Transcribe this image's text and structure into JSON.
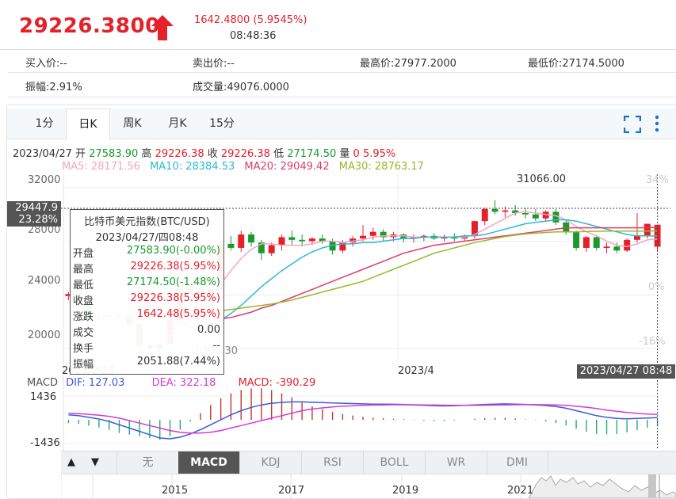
{
  "quote": {
    "price": "29226.3800",
    "change": "1642.4800 (5.9545%)",
    "time": "08:48:36"
  },
  "info": {
    "bid": "买入价:--",
    "ask": "卖出价:--",
    "high": "最高价:27977.2000",
    "low": "最低价:27174.5000",
    "amplitude": "振幅:2.91%",
    "volume": "成交量:49076.0000"
  },
  "tabs": [
    "1分",
    "日K",
    "周K",
    "月K",
    "15分"
  ],
  "active_tab": "日K",
  "ohlc_line": {
    "date": "2023/04/27",
    "open_label": "开",
    "open": "27583.90",
    "high_label": "高",
    "high": "29226.38",
    "close_label": "收",
    "close": "29226.38",
    "low_label": "低",
    "low": "27174.50",
    "vol_label": "量",
    "vol": "0",
    "pct": "5.95%"
  },
  "ma_line": {
    "ma5": "MA5: 28171.56",
    "ma10": "MA10: 28384.53",
    "ma20": "MA20: 29049.42",
    "ma30": "MA30: 28763.17"
  },
  "tooltip": {
    "title": "比特币美元指数(BTC/USD)",
    "datetime": "2023/04/27/四08:48",
    "rows": [
      {
        "k": "开盘",
        "v": "27583.90(-0.00%)",
        "c": "green"
      },
      {
        "k": "最高",
        "v": "29226.38(5.95%)",
        "c": "red"
      },
      {
        "k": "最低",
        "v": "27174.50(-1.48%)",
        "c": "green"
      },
      {
        "k": "收盘",
        "v": "29226.38(5.95%)",
        "c": "red"
      },
      {
        "k": "涨跌",
        "v": "1642.48(5.95%)",
        "c": "red"
      },
      {
        "k": "成交",
        "v": "0.00",
        "c": "dark"
      },
      {
        "k": "换手",
        "v": "--",
        "c": "dark"
      },
      {
        "k": "振幅",
        "v": "2051.88(7.44%)",
        "c": "dark"
      }
    ]
  },
  "chart_labels": {
    "peak": "31066.00",
    "trough": "19342.30",
    "cursor_price": "29447.9",
    "cursor_pct": "23.28%",
    "x_start": "2023/2/23",
    "x_mid": "2023/4",
    "x_cursor": "2023/04/27 08:48",
    "pct_top": "34%",
    "pct_zero": "0%",
    "pct_low": "-16%"
  },
  "macd": {
    "label": "MACD",
    "dif": "DIF: 127.03",
    "dea": "DEA: 322.18",
    "macd": "MACD: -390.29",
    "ytop": "1436",
    "ybot": "-1436"
  },
  "indicators": [
    "无",
    "MACD",
    "KDJ",
    "RSI",
    "BOLL",
    "WR",
    "DMI"
  ],
  "active_indicator": "MACD",
  "nav": {
    "up": "▲",
    "down": "▼"
  },
  "overview_years": [
    "2015",
    "2017",
    "2019",
    "2021"
  ],
  "chart_data": {
    "type": "candlestick",
    "title": "比特币美元指数(BTC/USD)",
    "y_axis_ticks": [
      20000,
      24000,
      28000,
      32000
    ],
    "ylim": [
      18800,
      33000
    ],
    "x_labels": [
      "2023/2/23",
      "2023/4",
      "2023/04/27 08:48"
    ],
    "candles": [
      {
        "o": 23900,
        "h": 24200,
        "l": 23600,
        "c": 24050
      },
      {
        "o": 24050,
        "h": 24150,
        "l": 23300,
        "c": 23400
      },
      {
        "o": 23400,
        "h": 23600,
        "l": 22100,
        "c": 22300
      },
      {
        "o": 22300,
        "h": 22500,
        "l": 22000,
        "c": 22350
      },
      {
        "o": 22350,
        "h": 22500,
        "l": 21900,
        "c": 22400
      },
      {
        "o": 22400,
        "h": 22600,
        "l": 22200,
        "c": 22450
      },
      {
        "o": 22450,
        "h": 22550,
        "l": 21700,
        "c": 21800
      },
      {
        "o": 21800,
        "h": 22000,
        "l": 19500,
        "c": 20200
      },
      {
        "o": 20200,
        "h": 20400,
        "l": 19700,
        "c": 20000
      },
      {
        "o": 20000,
        "h": 20500,
        "l": 19342.3,
        "c": 20300
      },
      {
        "o": 20300,
        "h": 22400,
        "l": 20200,
        "c": 22100
      },
      {
        "o": 22100,
        "h": 24600,
        "l": 21900,
        "c": 24200
      },
      {
        "o": 24200,
        "h": 24900,
        "l": 24000,
        "c": 24500
      },
      {
        "o": 24500,
        "h": 24800,
        "l": 23900,
        "c": 24100
      },
      {
        "o": 24100,
        "h": 24600,
        "l": 23800,
        "c": 24400
      },
      {
        "o": 24400,
        "h": 28200,
        "l": 24300,
        "c": 27800
      },
      {
        "o": 27800,
        "h": 28400,
        "l": 27300,
        "c": 27500
      },
      {
        "o": 27500,
        "h": 28800,
        "l": 27200,
        "c": 28500
      },
      {
        "o": 28500,
        "h": 28700,
        "l": 27600,
        "c": 27900
      },
      {
        "o": 27900,
        "h": 28100,
        "l": 26600,
        "c": 27100
      },
      {
        "o": 27100,
        "h": 27900,
        "l": 26900,
        "c": 27700
      },
      {
        "o": 27700,
        "h": 28500,
        "l": 27300,
        "c": 28300
      },
      {
        "o": 28300,
        "h": 28800,
        "l": 27700,
        "c": 28100
      },
      {
        "o": 28100,
        "h": 28500,
        "l": 27600,
        "c": 28000
      },
      {
        "o": 28000,
        "h": 28300,
        "l": 27700,
        "c": 28200
      },
      {
        "o": 28200,
        "h": 28500,
        "l": 27800,
        "c": 28000
      },
      {
        "o": 28000,
        "h": 28200,
        "l": 27000,
        "c": 27300
      },
      {
        "o": 27300,
        "h": 28100,
        "l": 27100,
        "c": 27900
      },
      {
        "o": 27900,
        "h": 28400,
        "l": 27600,
        "c": 28200
      },
      {
        "o": 28200,
        "h": 29200,
        "l": 28000,
        "c": 28400
      },
      {
        "o": 28400,
        "h": 29000,
        "l": 28100,
        "c": 28700
      },
      {
        "o": 28700,
        "h": 28900,
        "l": 28000,
        "c": 28300
      },
      {
        "o": 28300,
        "h": 28700,
        "l": 28000,
        "c": 28500
      },
      {
        "o": 28500,
        "h": 28600,
        "l": 27900,
        "c": 28200
      },
      {
        "o": 28200,
        "h": 28500,
        "l": 27900,
        "c": 28300
      },
      {
        "o": 28300,
        "h": 28500,
        "l": 28000,
        "c": 28400
      },
      {
        "o": 28400,
        "h": 28600,
        "l": 28100,
        "c": 28200
      },
      {
        "o": 28200,
        "h": 28500,
        "l": 28000,
        "c": 28300
      },
      {
        "o": 28300,
        "h": 28600,
        "l": 28000,
        "c": 28200
      },
      {
        "o": 28200,
        "h": 28500,
        "l": 28000,
        "c": 28400
      },
      {
        "o": 28400,
        "h": 29500,
        "l": 28200,
        "c": 29500
      },
      {
        "o": 29500,
        "h": 30500,
        "l": 29200,
        "c": 30400
      },
      {
        "o": 30400,
        "h": 31066,
        "l": 30000,
        "c": 30200
      },
      {
        "o": 30200,
        "h": 30600,
        "l": 29800,
        "c": 30300
      },
      {
        "o": 30300,
        "h": 30700,
        "l": 29900,
        "c": 30100
      },
      {
        "o": 30100,
        "h": 30500,
        "l": 29700,
        "c": 30000
      },
      {
        "o": 30000,
        "h": 30400,
        "l": 29500,
        "c": 29700
      },
      {
        "o": 29700,
        "h": 30300,
        "l": 29500,
        "c": 30200
      },
      {
        "o": 30200,
        "h": 30400,
        "l": 29200,
        "c": 29400
      },
      {
        "o": 29400,
        "h": 29600,
        "l": 28500,
        "c": 28700
      },
      {
        "o": 28700,
        "h": 28800,
        "l": 27300,
        "c": 27500
      },
      {
        "o": 27500,
        "h": 28400,
        "l": 27200,
        "c": 28300
      },
      {
        "o": 28300,
        "h": 28400,
        "l": 27300,
        "c": 27500
      },
      {
        "o": 27500,
        "h": 27900,
        "l": 27100,
        "c": 27600
      },
      {
        "o": 27600,
        "h": 27900,
        "l": 27100,
        "c": 27300
      },
      {
        "o": 27300,
        "h": 28200,
        "l": 27200,
        "c": 28100
      },
      {
        "o": 28100,
        "h": 30100,
        "l": 27900,
        "c": 28400
      },
      {
        "o": 28400,
        "h": 29300,
        "l": 28200,
        "c": 29300
      },
      {
        "o": 27583.9,
        "h": 29226.38,
        "l": 27174.5,
        "c": 29226.38
      }
    ],
    "series": [
      {
        "name": "MA5",
        "color": "#f4a6c0",
        "values": [
          23900,
          23700,
          23200,
          22900,
          22700,
          22500,
          22200,
          21900,
          21500,
          21100,
          20900,
          21400,
          22200,
          23000,
          23900,
          24800,
          25800,
          26700,
          27400,
          27800,
          27800,
          27700,
          27700,
          27700,
          27800,
          28000,
          28000,
          27900,
          28000,
          28100,
          28300,
          28400,
          28400,
          28400,
          28300,
          28300,
          28300,
          28300,
          28300,
          28300,
          28500,
          28900,
          29300,
          29700,
          30100,
          30200,
          30100,
          30000,
          29900,
          29600,
          29100,
          28700,
          28400,
          28000,
          27700,
          27600,
          27800,
          28100,
          28171.56
        ]
      },
      {
        "name": "MA10",
        "color": "#2db8d6",
        "values": [
          null,
          null,
          null,
          null,
          null,
          null,
          23300,
          23000,
          22700,
          22400,
          22100,
          21800,
          21600,
          21600,
          21800,
          22100,
          22600,
          23200,
          23900,
          24600,
          25200,
          25800,
          26300,
          26800,
          27200,
          27500,
          27700,
          27800,
          27800,
          27900,
          27900,
          28000,
          28100,
          28200,
          28200,
          28300,
          28300,
          28300,
          28300,
          28400,
          28400,
          28500,
          28700,
          28900,
          29100,
          29300,
          29400,
          29500,
          29600,
          29600,
          29500,
          29300,
          29100,
          28900,
          28700,
          28500,
          28400,
          28400,
          28384.53
        ]
      },
      {
        "name": "MA20",
        "color": "#e03c6a",
        "values": [
          null,
          null,
          null,
          null,
          null,
          null,
          null,
          null,
          null,
          null,
          null,
          null,
          22300,
          22200,
          22200,
          22200,
          22300,
          22500,
          22700,
          23000,
          23200,
          23500,
          23800,
          24100,
          24400,
          24700,
          25000,
          25300,
          25600,
          25900,
          26200,
          26500,
          26800,
          27100,
          27300,
          27500,
          27700,
          27800,
          27900,
          28000,
          28100,
          28200,
          28300,
          28400,
          28500,
          28600,
          28700,
          28800,
          28900,
          29000,
          29000,
          29000,
          29000,
          29000,
          29000,
          29000,
          29000,
          29000,
          29049.42
        ]
      },
      {
        "name": "MA30",
        "color": "#98b82a",
        "values": [
          null,
          null,
          null,
          null,
          null,
          null,
          null,
          null,
          null,
          null,
          null,
          null,
          22600,
          22600,
          22700,
          22800,
          22900,
          23000,
          23100,
          23200,
          23300,
          23450,
          23600,
          23800,
          24000,
          24200,
          24400,
          24600,
          24800,
          25000,
          25300,
          25600,
          25900,
          26200,
          26500,
          26800,
          27100,
          27300,
          27500,
          27700,
          27900,
          28050,
          28200,
          28350,
          28450,
          28550,
          28600,
          28650,
          28700,
          28700,
          28700,
          28720,
          28740,
          28750,
          28760,
          28760,
          28760,
          28760,
          28763.17
        ]
      }
    ],
    "macd_series": {
      "dif": [
        300,
        250,
        150,
        50,
        -100,
        -300,
        -500,
        -700,
        -900,
        -1100,
        -1150,
        -1050,
        -850,
        -600,
        -300,
        0,
        300,
        550,
        750,
        900,
        1000,
        1050,
        1080,
        1080,
        1060,
        1040,
        1020,
        1000,
        980,
        960,
        950,
        950,
        940,
        930,
        900,
        870,
        850,
        840,
        850,
        870,
        900,
        930,
        950,
        960,
        950,
        930,
        900,
        860,
        800,
        700,
        550,
        400,
        250,
        150,
        80,
        60,
        80,
        110,
        127.03
      ],
      "dea": [
        400,
        370,
        330,
        280,
        210,
        100,
        -50,
        -200,
        -350,
        -500,
        -650,
        -750,
        -800,
        -800,
        -750,
        -650,
        -500,
        -350,
        -200,
        -50,
        100,
        250,
        400,
        550,
        650,
        720,
        780,
        820,
        850,
        870,
        890,
        900,
        910,
        910,
        910,
        900,
        890,
        880,
        870,
        870,
        870,
        880,
        890,
        900,
        910,
        915,
        915,
        910,
        900,
        870,
        820,
        760,
        680,
        590,
        510,
        440,
        390,
        350,
        322.18
      ],
      "macd": [
        -200,
        -240,
        -360,
        -460,
        -620,
        -800,
        -900,
        -1000,
        -1100,
        -1200,
        -1000,
        -600,
        -100,
        400,
        900,
        1300,
        1600,
        1800,
        1900,
        1900,
        1800,
        1600,
        1360,
        1060,
        820,
        640,
        480,
        360,
        260,
        180,
        120,
        100,
        60,
        40,
        -20,
        -60,
        -80,
        -80,
        -40,
        0,
        60,
        100,
        120,
        120,
        80,
        30,
        -30,
        -100,
        -200,
        -340,
        -540,
        -720,
        -860,
        -880,
        -860,
        -760,
        -620,
        -480,
        -390.29
      ]
    }
  },
  "colors": {
    "up": "#e4202a",
    "down": "#1a9a2c",
    "accent": "#1a73c8"
  }
}
